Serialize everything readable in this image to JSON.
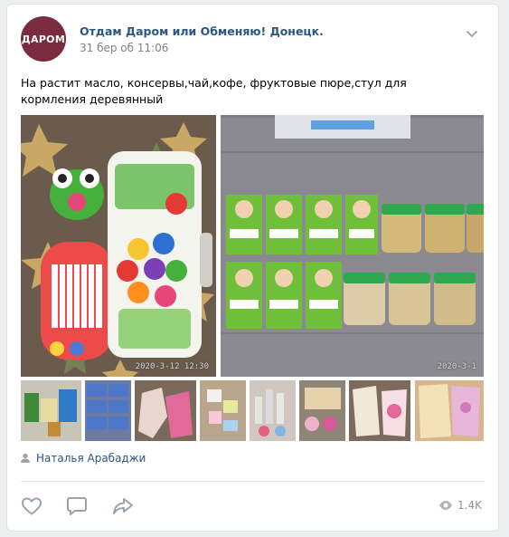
{
  "post": {
    "group_avatar_text": "ДАРОМ",
    "group_name": "Отдам Даром или Обменяю! Донецк.",
    "date": "31 бер об 11:06",
    "text": "На растит масло, консервы,чай,кофе, фруктовые пюре,стул для кормления деревянный",
    "photo_timestamps": [
      "2020-3-12 12:30",
      "2020-3-1"
    ],
    "author_name": "Наталья Арабаджи",
    "views": "1.4K"
  },
  "colors": {
    "link": "#2a5885",
    "muted": "#828282",
    "icon": "#99a2ad",
    "avatar_bg": "#7a2b3d"
  }
}
